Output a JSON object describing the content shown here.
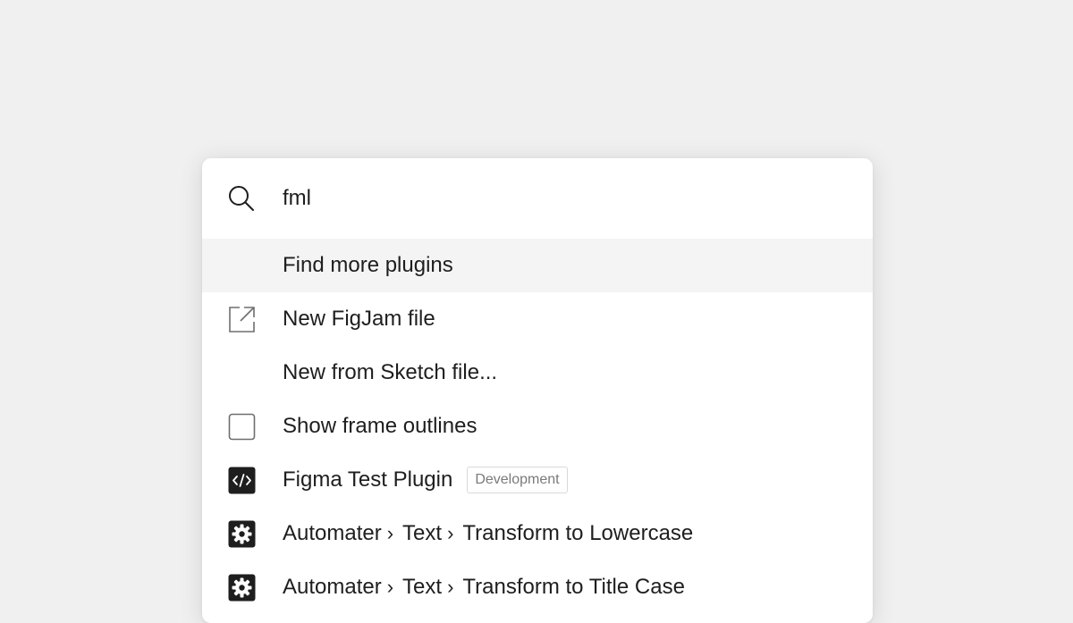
{
  "search": {
    "value": "fml",
    "icon": "search-icon"
  },
  "results": [
    {
      "label": "Find more plugins",
      "icon": "none",
      "selected": true
    },
    {
      "label": "New FigJam file",
      "icon": "external-link-icon"
    },
    {
      "label": "New from Sketch file...",
      "icon": "none"
    },
    {
      "label": "Show frame outlines",
      "icon": "checkbox-icon"
    },
    {
      "label": "Figma Test Plugin",
      "icon": "code-icon",
      "badge": "Development"
    },
    {
      "crumbs": [
        "Automater",
        "Text",
        "Transform to Lowercase"
      ],
      "separator": "›",
      "icon": "gear-icon"
    },
    {
      "crumbs": [
        "Automater",
        "Text",
        "Transform to Title Case"
      ],
      "separator": "›",
      "icon": "gear-icon"
    }
  ],
  "colors": {
    "background": "#f0f0f0",
    "panel": "#ffffff",
    "selected_row": "#f4f4f4",
    "text": "#1e1e1e",
    "badge_text": "#7a7a7a"
  }
}
